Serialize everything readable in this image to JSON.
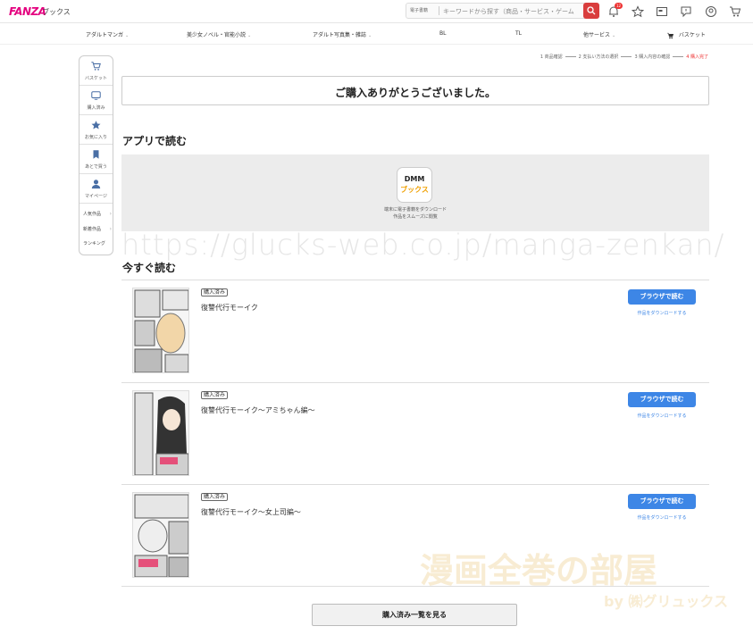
{
  "header": {
    "logo": "FANZA",
    "logo_sub": "ブックス",
    "search_category": "電子書籍",
    "search_placeholder": "キーワードから探す（商品・サービス・ゲーム",
    "notification_count": "12"
  },
  "nav": [
    {
      "label": "アダルトマンガ",
      "chevron": "⌄"
    },
    {
      "label": "美少女ノベル・官能小説",
      "chevron": "⌄"
    },
    {
      "label": "アダルト写真集・雑誌",
      "chevron": "⌄"
    },
    {
      "label": "BL",
      "chevron": ""
    },
    {
      "label": "TL",
      "chevron": ""
    },
    {
      "label": "他サービス",
      "chevron": "⌄"
    },
    {
      "label": "バスケット",
      "chevron": ""
    }
  ],
  "steps": [
    "1 商品確認",
    "2 支払い方法の選択",
    "3 購入内容の確認",
    "4 購入完了"
  ],
  "sidebar": {
    "items": [
      {
        "label": "バスケット",
        "icon": "basket-icon"
      },
      {
        "label": "購入済み",
        "icon": "book-icon"
      },
      {
        "label": "お気に入り",
        "icon": "star-icon"
      },
      {
        "label": "あとで買う",
        "icon": "bookmark-icon"
      },
      {
        "label": "マイページ",
        "icon": "user-icon"
      }
    ],
    "links": [
      "人気作品",
      "新着作品",
      "ランキング"
    ]
  },
  "thanks": "ご購入ありがとうございました。",
  "app_section": {
    "title": "アプリで読む",
    "icon_line1": "DMM",
    "icon_line2": "ブックス",
    "desc_line1": "端末に電子書籍をダウンロード",
    "desc_line2": "作品をスムーズに閲覧"
  },
  "watermark": "https://glucks-web.co.jp/manga-zenkan/",
  "brand_watermark": {
    "main": "漫画全巻の部屋",
    "sub": "by ㈱グリュックス"
  },
  "read_now": {
    "title": "今すぐ読む",
    "books": [
      {
        "tag": "購入済み",
        "title": "復讐代行モーイク",
        "read_label": "ブラウザで読む",
        "download_label": "作品をダウンロードする"
      },
      {
        "tag": "購入済み",
        "title": "復讐代行モーイク〜アミちゃん編〜",
        "read_label": "ブラウザで読む",
        "download_label": "作品をダウンロードする"
      },
      {
        "tag": "購入済み",
        "title": "復讐代行モーイク〜女上司編〜",
        "read_label": "ブラウザで読む",
        "download_label": "作品をダウンロードする"
      }
    ]
  },
  "purchased_list_button": "購入済み一覧を見る",
  "colors": {
    "accent": "#3d86e6",
    "search": "#d93d3d",
    "brand": "#e4007f"
  }
}
